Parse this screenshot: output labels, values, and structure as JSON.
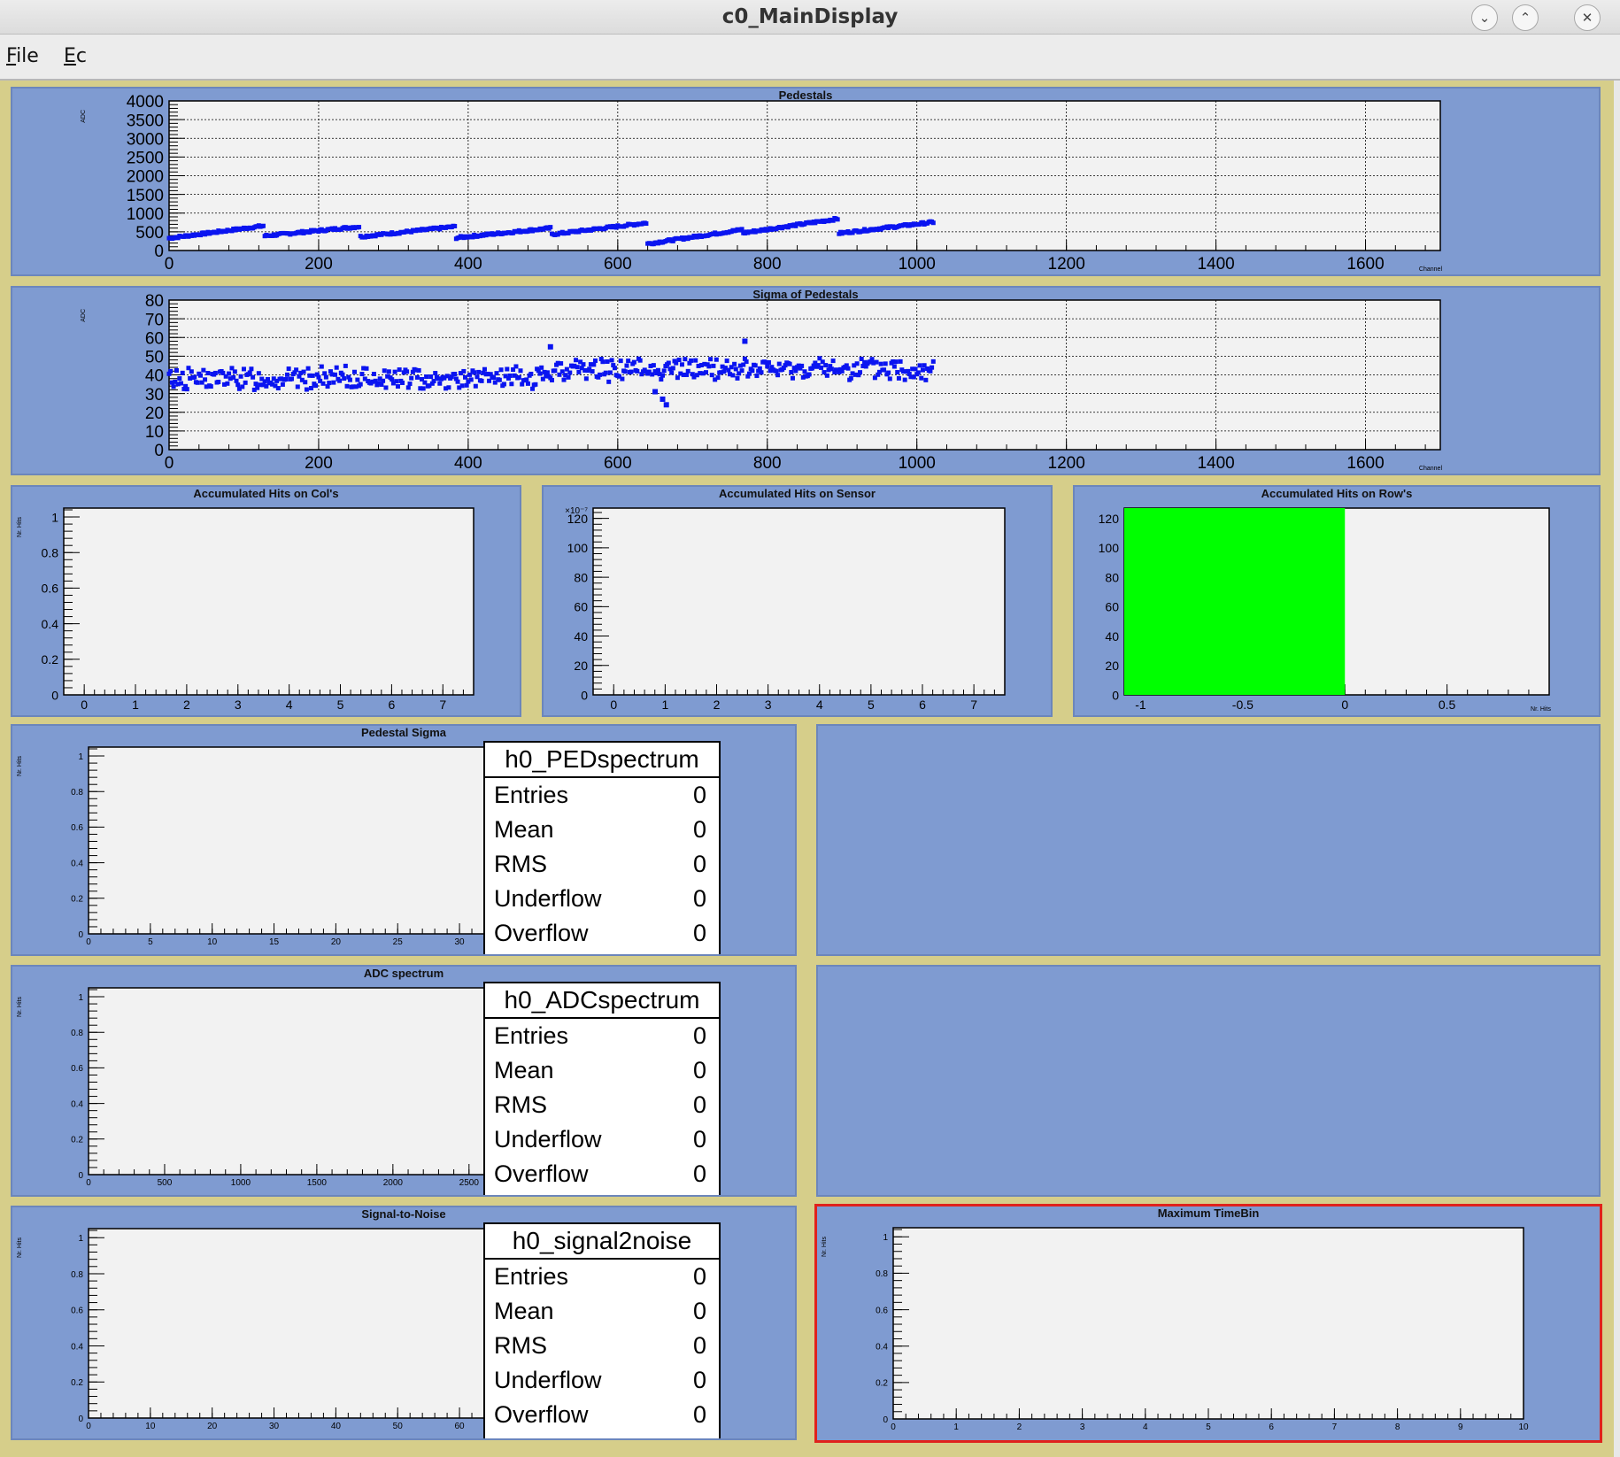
{
  "window": {
    "title": "c0_MainDisplay",
    "minimize_glyph": "⌄",
    "maximize_glyph": "⌃",
    "close_glyph": "✕"
  },
  "menubar": {
    "items": [
      {
        "label": "File",
        "mnemonic": "F"
      },
      {
        "label": "Ec",
        "mnemonic": "E"
      }
    ]
  },
  "colors": {
    "pad_bg": "#7f9bd1",
    "frame_bg": "#f2f2f2",
    "marker": "#0a14f0",
    "fill_green": "#00ff00",
    "selected_border": "#e0221c"
  },
  "pads": {
    "pedestals": {
      "title": "Pedestals",
      "ylabel": "ADC",
      "xlabel": "Channel"
    },
    "sigma": {
      "title": "Sigma of Pedestals",
      "ylabel": "ADC",
      "xlabel": "Channel"
    },
    "cols": {
      "title": "Accumulated Hits on Col's",
      "ylabel": "Nr. Hits"
    },
    "sensor": {
      "title": "Accumulated Hits on Sensor",
      "exponent": "×10⁻⁷"
    },
    "rows": {
      "title": "Accumulated Hits on Row's",
      "xlabel": "Nr. Hits"
    },
    "pedsigma": {
      "title": "Pedestal Sigma",
      "ylabel": "Nr. Hits"
    },
    "adc": {
      "title": "ADC spectrum",
      "ylabel": "Nr. Hits"
    },
    "s2n": {
      "title": "Signal-to-Noise",
      "ylabel": "Nr. Hits"
    },
    "maxtime": {
      "title": "Maximum TimeBin",
      "ylabel": "Nr. Hits"
    }
  },
  "statboxes": {
    "ped": {
      "name": "h0_PEDspectrum",
      "rows": [
        {
          "k": "Entries",
          "v": "0"
        },
        {
          "k": "Mean",
          "v": "0"
        },
        {
          "k": "RMS",
          "v": "0"
        },
        {
          "k": "Underflow",
          "v": "0"
        },
        {
          "k": "Overflow",
          "v": "0"
        }
      ]
    },
    "adc": {
      "name": "h0_ADCspectrum",
      "rows": [
        {
          "k": "Entries",
          "v": "0"
        },
        {
          "k": "Mean",
          "v": "0"
        },
        {
          "k": "RMS",
          "v": "0"
        },
        {
          "k": "Underflow",
          "v": "0"
        },
        {
          "k": "Overflow",
          "v": "0"
        }
      ]
    },
    "s2n": {
      "name": "h0_signal2noise",
      "rows": [
        {
          "k": "Entries",
          "v": "0"
        },
        {
          "k": "Mean",
          "v": "0"
        },
        {
          "k": "RMS",
          "v": "0"
        },
        {
          "k": "Underflow",
          "v": "0"
        },
        {
          "k": "Overflow",
          "v": "0"
        }
      ]
    }
  },
  "chart_data": [
    {
      "id": "pedestals",
      "type": "scatter",
      "title": "Pedestals",
      "xlabel": "Channel",
      "ylabel": "ADC",
      "xlim": [
        0,
        1700
      ],
      "ylim": [
        0,
        4000
      ],
      "xticks": [
        "0",
        "200",
        "400",
        "600",
        "800",
        "1000",
        "1200",
        "1400",
        "1600"
      ],
      "yticks": [
        "0",
        "500",
        "1000",
        "1500",
        "2000",
        "2500",
        "3000",
        "3500",
        "4000"
      ],
      "segments": [
        {
          "x": [
            0,
            127
          ],
          "y": [
            330,
            660
          ]
        },
        {
          "x": [
            128,
            255
          ],
          "y": [
            390,
            640
          ]
        },
        {
          "x": [
            256,
            383
          ],
          "y": [
            370,
            640
          ]
        },
        {
          "x": [
            384,
            511
          ],
          "y": [
            340,
            600
          ]
        },
        {
          "x": [
            512,
            639
          ],
          "y": [
            430,
            740
          ]
        },
        {
          "x": [
            640,
            767
          ],
          "y": [
            180,
            560
          ]
        },
        {
          "x": [
            768,
            895
          ],
          "y": [
            470,
            850
          ]
        },
        {
          "x": [
            896,
            1023
          ],
          "y": [
            460,
            760
          ]
        }
      ]
    },
    {
      "id": "sigma",
      "type": "scatter",
      "title": "Sigma of Pedestals",
      "xlabel": "Channel",
      "ylabel": "ADC",
      "xlim": [
        0,
        1700
      ],
      "ylim": [
        0,
        80
      ],
      "xticks": [
        "0",
        "200",
        "400",
        "600",
        "800",
        "1000",
        "1200",
        "1400",
        "1600"
      ],
      "yticks": [
        "0",
        "10",
        "20",
        "30",
        "40",
        "50",
        "60",
        "70",
        "80"
      ],
      "bands": [
        {
          "x": [
            0,
            511
          ],
          "center": 38,
          "spread": 7
        },
        {
          "x": [
            512,
            767
          ],
          "center": 43,
          "spread": 7
        },
        {
          "x": [
            768,
            1023
          ],
          "center": 43,
          "spread": 7
        }
      ],
      "outliers": [
        {
          "x": 660,
          "y": 27
        },
        {
          "x": 665,
          "y": 24
        },
        {
          "x": 650,
          "y": 31
        },
        {
          "x": 510,
          "y": 55
        },
        {
          "x": 770,
          "y": 58
        }
      ]
    },
    {
      "id": "cols",
      "type": "bar",
      "title": "Accumulated Hits on Col's",
      "ylabel": "Nr. Hits",
      "xlim": [
        -0.4,
        7.6
      ],
      "ylim": [
        0,
        1.05
      ],
      "xticks": [
        "0",
        "1",
        "2",
        "3",
        "4",
        "5",
        "6",
        "7"
      ],
      "yticks": [
        "0",
        "0.2",
        "0.4",
        "0.6",
        "0.8",
        "1"
      ],
      "values": []
    },
    {
      "id": "sensor",
      "type": "heatmap",
      "title": "Accumulated Hits on Sensor",
      "xlim": [
        -0.4,
        7.6
      ],
      "ylim": [
        0,
        127
      ],
      "xticks": [
        "0",
        "1",
        "2",
        "3",
        "4",
        "5",
        "6",
        "7"
      ],
      "yticks": [
        "0",
        "20",
        "40",
        "60",
        "80",
        "100",
        "120"
      ],
      "values": []
    },
    {
      "id": "rows",
      "type": "bar",
      "title": "Accumulated Hits on Row's",
      "xlabel": "Nr. Hits",
      "xlim": [
        -1.08,
        1.0
      ],
      "ylim": [
        0,
        127
      ],
      "xticks": [
        "-1",
        "-0.5",
        "0",
        "0.5"
      ],
      "yticks": [
        "0",
        "20",
        "40",
        "60",
        "80",
        "100",
        "120"
      ],
      "bars": [
        {
          "x0": -1.08,
          "x1": 0,
          "y0": 0,
          "y1": 127
        }
      ]
    },
    {
      "id": "pedsigma",
      "type": "bar",
      "title": "Pedestal Sigma",
      "ylabel": "Nr. Hits",
      "xlim": [
        0,
        32
      ],
      "ylim": [
        0,
        1.05
      ],
      "xticks": [
        "0",
        "5",
        "10",
        "15",
        "20",
        "25",
        "30"
      ],
      "yticks": [
        "0",
        "0.2",
        "0.4",
        "0.6",
        "0.8",
        "1"
      ],
      "values": []
    },
    {
      "id": "adc",
      "type": "bar",
      "title": "ADC spectrum",
      "ylabel": "Nr. Hits",
      "xlim": [
        0,
        2600
      ],
      "ylim": [
        0,
        1.05
      ],
      "xticks": [
        "0",
        "500",
        "1000",
        "1500",
        "2000",
        "2500"
      ],
      "yticks": [
        "0",
        "0.2",
        "0.4",
        "0.6",
        "0.8",
        "1"
      ],
      "values": []
    },
    {
      "id": "s2n",
      "type": "bar",
      "title": "Signal-to-Noise",
      "ylabel": "Nr. Hits",
      "xlim": [
        0,
        64
      ],
      "ylim": [
        0,
        1.05
      ],
      "xticks": [
        "0",
        "10",
        "20",
        "30",
        "40",
        "50",
        "60"
      ],
      "yticks": [
        "0",
        "0.2",
        "0.4",
        "0.6",
        "0.8",
        "1"
      ],
      "values": []
    },
    {
      "id": "maxtime",
      "type": "bar",
      "title": "Maximum TimeBin",
      "ylabel": "Nr. Hits",
      "xlim": [
        0,
        10
      ],
      "ylim": [
        0,
        1.05
      ],
      "xticks": [
        "0",
        "1",
        "2",
        "3",
        "4",
        "5",
        "6",
        "7",
        "8",
        "9",
        "10"
      ],
      "yticks": [
        "0",
        "0.2",
        "0.4",
        "0.6",
        "0.8",
        "1"
      ],
      "values": []
    }
  ]
}
